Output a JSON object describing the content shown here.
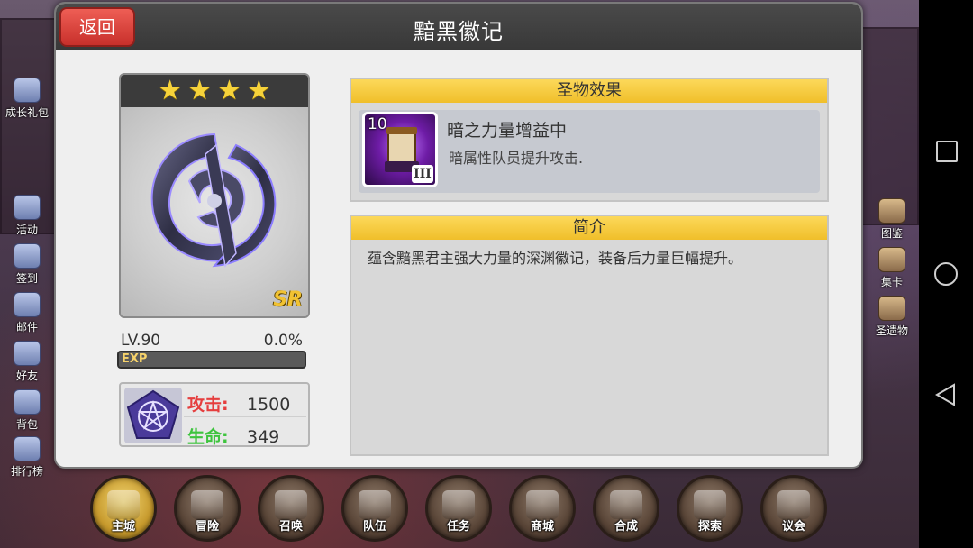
{
  "dialog": {
    "title": "黯黑徽记",
    "back_label": "返回"
  },
  "item": {
    "stars": 4,
    "rarity": "SR",
    "level": "LV.90",
    "exp_percent": "0.0%",
    "exp_fraction": 0.0,
    "exp_label": "EXP",
    "stats": [
      {
        "label": "攻击:",
        "value": "1500"
      },
      {
        "label": "生命:",
        "value": "349"
      }
    ],
    "stat_icon": "pentagram-icon"
  },
  "effect": {
    "header": "圣物效果",
    "skill_level": "10",
    "skill_tier": "III",
    "skill_name": "暗之力量增益中",
    "skill_desc": "暗属性队员提升攻击."
  },
  "intro": {
    "header": "简介",
    "text": "蕴含黯黑君主强大力量的深渊徽记，装备后力量巨幅提升。"
  },
  "left_menu": [
    {
      "label": "成长礼包",
      "icon": "gift-icon"
    },
    {
      "label": "活动",
      "icon": "megaphone-icon"
    },
    {
      "label": "签到",
      "icon": "checklist-icon"
    },
    {
      "label": "邮件",
      "icon": "mail-icon"
    },
    {
      "label": "好友",
      "icon": "friends-icon"
    },
    {
      "label": "背包",
      "icon": "backpack-icon"
    },
    {
      "label": "排行榜",
      "icon": "ranking-icon"
    }
  ],
  "right_menu": [
    {
      "label": "图鉴",
      "icon": "book-icon"
    },
    {
      "label": "集卡",
      "icon": "cards-icon"
    },
    {
      "label": "圣遗物",
      "icon": "relic-icon"
    }
  ],
  "bottom_nav": [
    {
      "label": "主城",
      "icon": "castle-icon",
      "active": true
    },
    {
      "label": "冒险",
      "icon": "swords-icon"
    },
    {
      "label": "召唤",
      "icon": "summon-card-icon"
    },
    {
      "label": "队伍",
      "icon": "crest-icon"
    },
    {
      "label": "任务",
      "icon": "scroll-icon"
    },
    {
      "label": "商城",
      "icon": "shop-icon"
    },
    {
      "label": "合成",
      "icon": "potion-icon"
    },
    {
      "label": "探索",
      "icon": "compass-icon"
    },
    {
      "label": "议会",
      "icon": "council-icon"
    }
  ],
  "colors": {
    "header_yellow": "#f0bf2a",
    "back_red": "#c8302b",
    "star": "#f6d23a",
    "attack": "#e53e3e",
    "health": "#3ec43e"
  }
}
